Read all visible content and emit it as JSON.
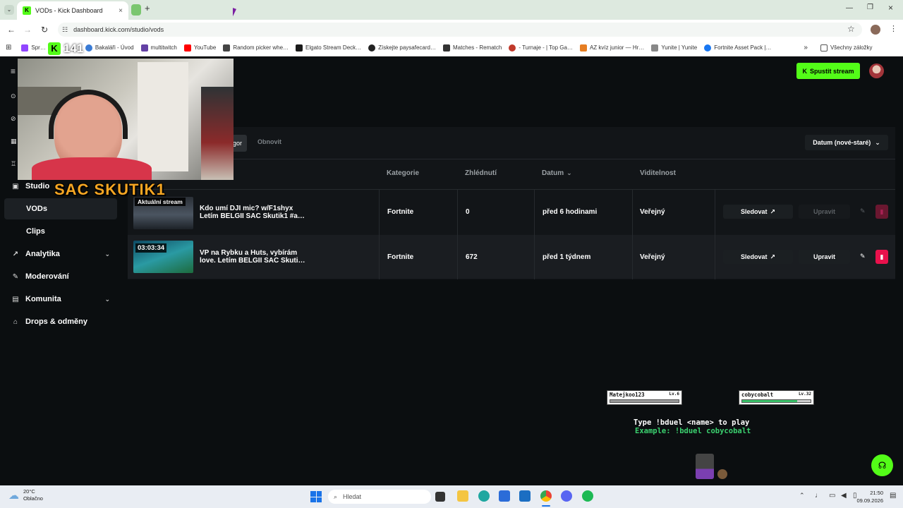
{
  "browser": {
    "tab_title": "VODs - Kick Dashboard",
    "url": "dashboard.kick.com/studio/vods",
    "bookmarks": [
      "Spr…",
      "Bakaláři - Úvod",
      "multitwitch",
      "YouTube",
      "Random picker whe…",
      "Elgato Stream Deck…",
      "Získejte paysafecard…",
      "Matches - Rematch",
      "- Turnaje - | Top Ga…",
      "AZ kvíz junior — Hr…",
      "Yunite | Yunite",
      "Fortnite Asset Pack |…"
    ],
    "all_bookmarks": "Všechny záložky"
  },
  "overlay": {
    "viewer_count": "141",
    "streamer_name": "SAC SKUTIK1",
    "duel_players": [
      {
        "name": "Matejkoo123",
        "level": "Lv.6",
        "hp_fraction": 1.0
      },
      {
        "name": "cobycobalt",
        "level": "Lv.32",
        "hp_fraction": 0.8
      }
    ],
    "duel_help_line1": "Type !bduel <name> to play",
    "duel_help_line2": "Example: !bduel cobycobalt"
  },
  "header": {
    "stream_button": "Spustit stream"
  },
  "sidebar": {
    "items": [
      {
        "label": "Studio",
        "icon": "studio-icon"
      },
      {
        "label": "VODs",
        "active": true
      },
      {
        "label": "Clips"
      },
      {
        "label": "Analytika",
        "icon": "analytics-icon",
        "expandable": true
      },
      {
        "label": "Moderování",
        "icon": "wrench-icon"
      },
      {
        "label": "Komunita",
        "icon": "community-icon",
        "expandable": true
      },
      {
        "label": "Drops & odměny",
        "icon": "gift-icon"
      }
    ]
  },
  "toolbar": {
    "partial_button": "gor",
    "refresh": "Obnovit",
    "sort": "Datum (nové-staré)"
  },
  "table": {
    "columns": [
      "Kategorie",
      "Zhlédnutí",
      "Datum",
      "Viditelnost"
    ],
    "rows": [
      {
        "badge": "Aktuální stream",
        "title_line1": "Kdo umí DJI mic? w/F1shyx",
        "title_line2": "Letím BELGII SAC Skutik1 #a…",
        "category": "Fortnite",
        "views": "0",
        "date": "před 6 hodinami",
        "visibility": "Veřejný",
        "watch": "Sledovat",
        "edit": "Upravit",
        "edit_enabled": false
      },
      {
        "badge": "03:03:34",
        "title_line1": "VP na Rybku a Huts, vybírám",
        "title_line2": "love. Letím BELGII SAC Skuti…",
        "category": "Fortnite",
        "views": "672",
        "date": "před 1 týdnem",
        "visibility": "Veřejný",
        "watch": "Sledovat",
        "edit": "Upravit",
        "edit_enabled": true
      }
    ]
  },
  "taskbar": {
    "weather_temp": "20°C",
    "weather_desc": "Oblačno",
    "search_placeholder": "Hledat",
    "time": "21:50",
    "date": "09.09.2026"
  },
  "colors": {
    "accent": "#53fc18",
    "delete": "#e9114c"
  }
}
